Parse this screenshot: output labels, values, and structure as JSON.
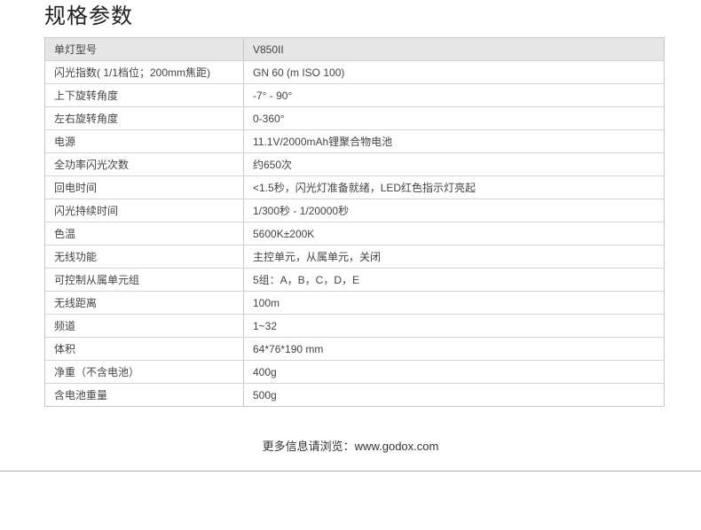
{
  "title": "规格参数",
  "table": {
    "rows": [
      {
        "key": "单灯型号",
        "value": "V850II"
      },
      {
        "key": "闪光指数( 1/1档位；200mm焦距)",
        "value": "GN 60 (m ISO 100)"
      },
      {
        "key": "上下旋转角度",
        "value": "-7° - 90°"
      },
      {
        "key": "左右旋转角度",
        "value": "0-360°"
      },
      {
        "key": "电源",
        "value": "11.1V/2000mAh锂聚合物电池"
      },
      {
        "key": "全功率闪光次数",
        "value": "约650次"
      },
      {
        "key": "回电时间",
        "value": "<1.5秒，闪光灯准备就绪，LED红色指示灯亮起"
      },
      {
        "key": "闪光持续时间",
        "value": "1/300秒 - 1/20000秒"
      },
      {
        "key": "色温",
        "value": "5600K±200K"
      },
      {
        "key": "无线功能",
        "value": "主控单元，从属单元，关闭"
      },
      {
        "key": "可控制从属单元组",
        "value": "5组：A，B，C，D，E"
      },
      {
        "key": "无线距离",
        "value": "100m"
      },
      {
        "key": "频道",
        "value": "1~32"
      },
      {
        "key": "体积",
        "value": "64*76*190 mm"
      },
      {
        "key": "净重（不含电池）",
        "value": "400g"
      },
      {
        "key": "含电池重量",
        "value": "500g"
      }
    ]
  },
  "footer": {
    "text": "更多信息请浏览：www.godox.com"
  },
  "colors": {
    "header_row_bg": "#e6e6e6",
    "divider": "#e8a050"
  }
}
